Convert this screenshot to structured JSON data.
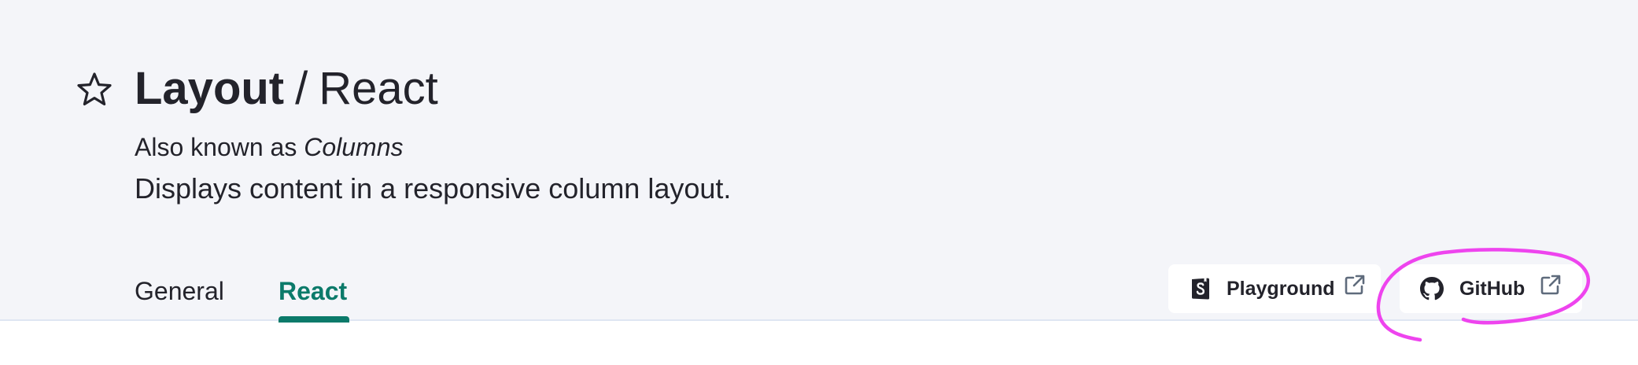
{
  "header": {
    "title_main": "Layout",
    "title_separator": "/",
    "title_sub": "React",
    "aka_prefix": "Also known as ",
    "aka_name": "Columns",
    "description": "Displays content in a responsive column layout."
  },
  "tabs": [
    {
      "label": "General",
      "active": false
    },
    {
      "label": "React",
      "active": true
    }
  ],
  "links": {
    "playground": {
      "label": "Playground",
      "icon": "storybook-icon"
    },
    "github": {
      "label": "GitHub",
      "icon": "github-icon"
    }
  },
  "colors": {
    "header_bg": "#f4f5f9",
    "accent": "#0b7a6a",
    "text": "#23232b",
    "annotation": "#ee44ee"
  }
}
